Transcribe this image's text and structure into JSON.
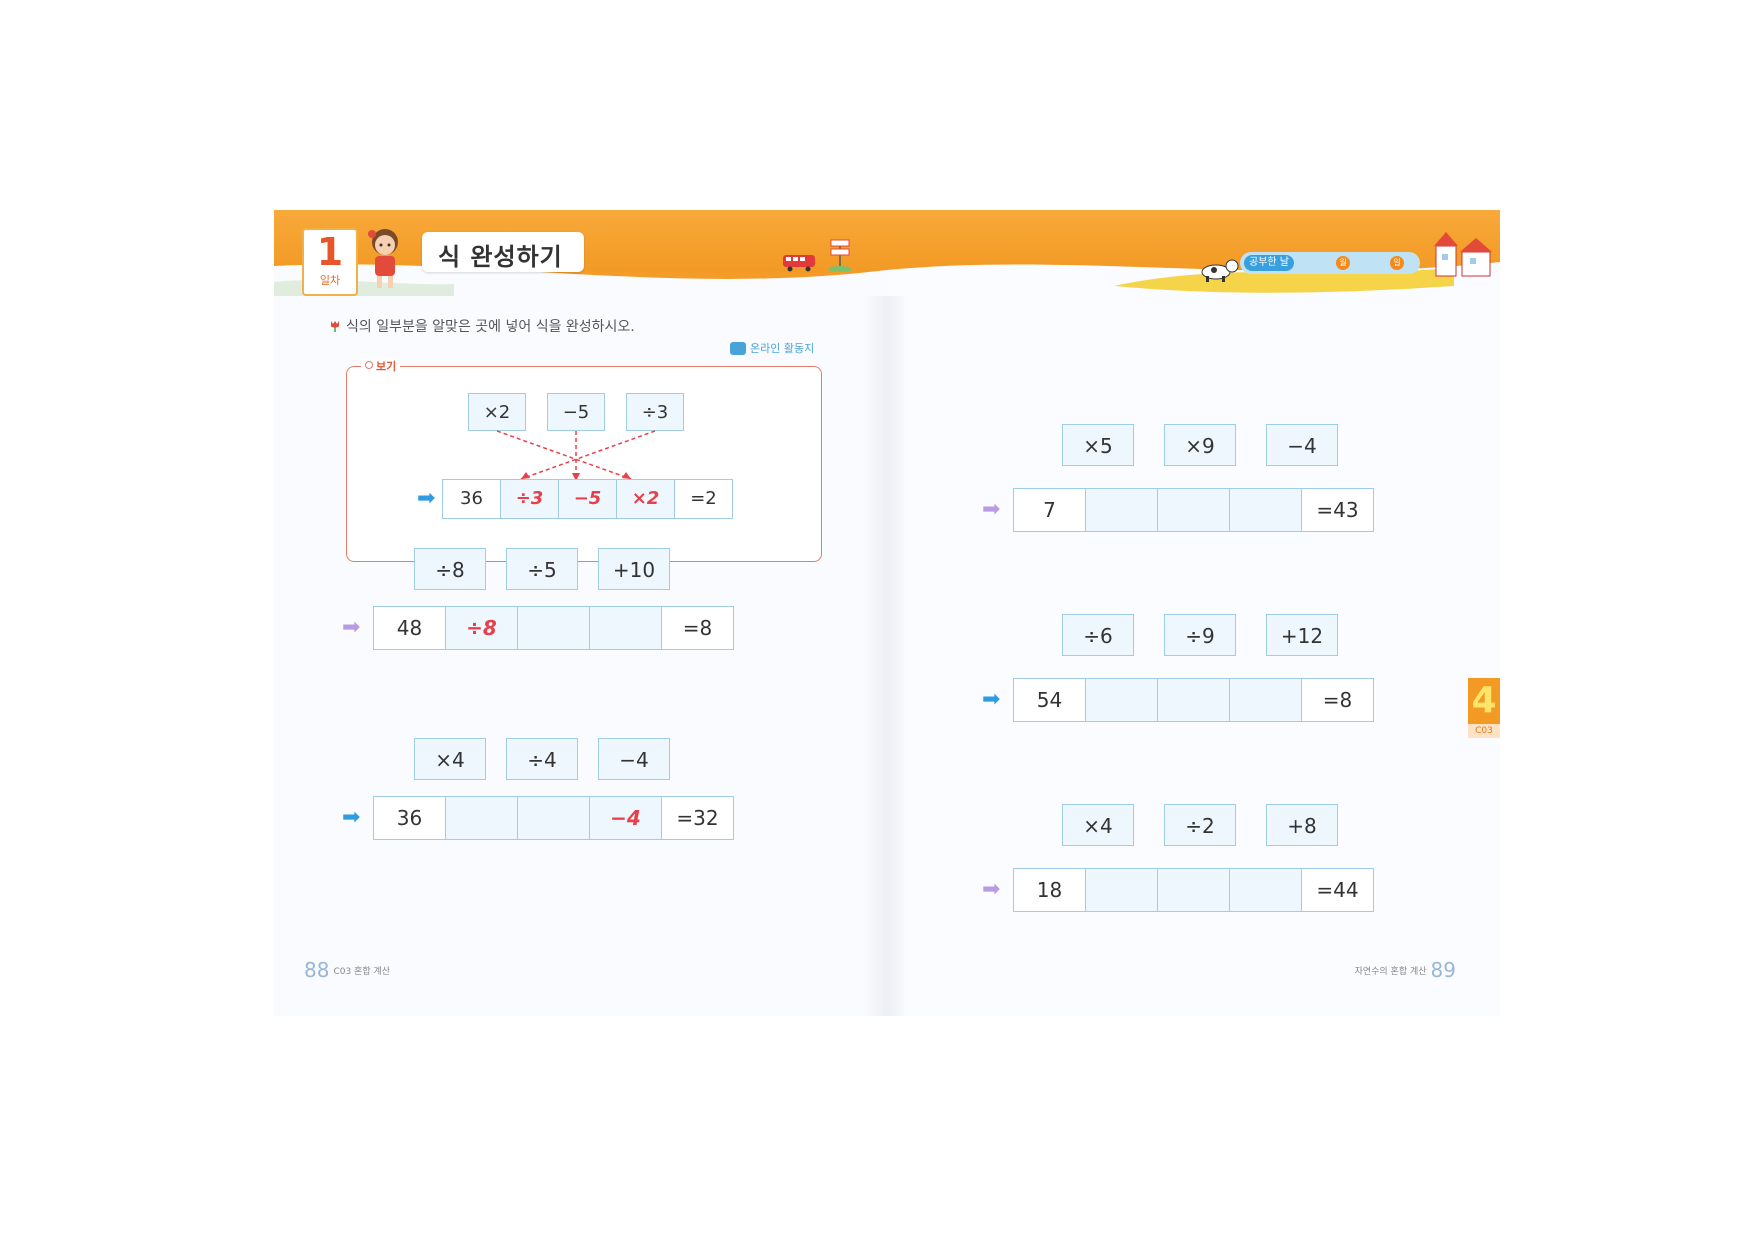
{
  "header": {
    "day_number": "1",
    "day_label": "일차",
    "title": "식 완성하기",
    "study_label": "공부한 날",
    "month_label": "월",
    "day_unit_label": "일"
  },
  "instructions": "식의 일부분을 알맞은 곳에 넣어 식을 완성하시오.",
  "online_activity": "온라인 활동지",
  "example": {
    "label": "보기",
    "ops": [
      "×2",
      "−5",
      "÷3"
    ],
    "cells": [
      "36",
      "÷3",
      "−5",
      "×2",
      "=2"
    ]
  },
  "problems": [
    {
      "ops": [
        "÷8",
        "÷5",
        "+10"
      ],
      "cells": [
        "48",
        "÷8",
        "",
        "",
        "=8"
      ]
    },
    {
      "ops": [
        "×4",
        "÷4",
        "−4"
      ],
      "cells": [
        "36",
        "",
        "",
        "−4",
        "=32"
      ]
    },
    {
      "ops": [
        "×5",
        "×9",
        "−4"
      ],
      "cells": [
        "7",
        "",
        "",
        "",
        "=43"
      ]
    },
    {
      "ops": [
        "÷6",
        "÷9",
        "+12"
      ],
      "cells": [
        "54",
        "",
        "",
        "",
        "=8"
      ]
    },
    {
      "ops": [
        "×4",
        "÷2",
        "+8"
      ],
      "cells": [
        "18",
        "",
        "",
        "",
        "=44"
      ]
    }
  ],
  "side_tab": {
    "number": "4",
    "code": "C03"
  },
  "footer": {
    "left_page": "88",
    "left_text": "C03 혼합 계산",
    "right_page": "89",
    "right_text": "자연수의 혼합 계산"
  },
  "colors": {
    "banner": "#f39a25",
    "filled_answer": "#e8404a",
    "cell_border": "#9fcde8",
    "arrow_blue": "#2f9be0",
    "arrow_purple": "#b79ce2"
  }
}
